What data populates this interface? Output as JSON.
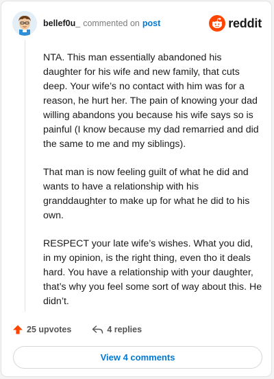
{
  "header": {
    "username": "bellef0u_",
    "meta_text": "commented on",
    "post_link": "post",
    "brand": "reddit"
  },
  "comment": {
    "paragraphs": [
      "NTA. This man essentially abandoned his daughter for his wife and new family, that cuts deep. Your wife’s no contact with him was for a reason, he hurt her. The pain of knowing your dad willing abandons you because his wife says so is painful (I know because my dad remarried and did the same to me and my siblings).",
      "That man is now feeling guilt of what he did and wants to have a relationship with his granddaughter to make up for what he did to his own.",
      "RESPECT your late wife’s wishes. What you did, in my opinion, is the right thing, even tho it deals hard. You have a relationship with your daughter, that’s why you feel some sort of way about this. He didn’t."
    ]
  },
  "actions": {
    "upvotes": "25 upvotes",
    "replies": "4 replies",
    "view_comments": "View 4 comments"
  },
  "colors": {
    "reddit_orange": "#ff4500",
    "link_blue": "#0079d3",
    "text": "#1a1a1b",
    "muted": "#7c7c7c"
  },
  "icons": {
    "avatar": "user-avatar",
    "logo": "reddit-snoo-icon",
    "upvote": "upvote-arrow-icon",
    "reply": "reply-arrow-icon"
  }
}
